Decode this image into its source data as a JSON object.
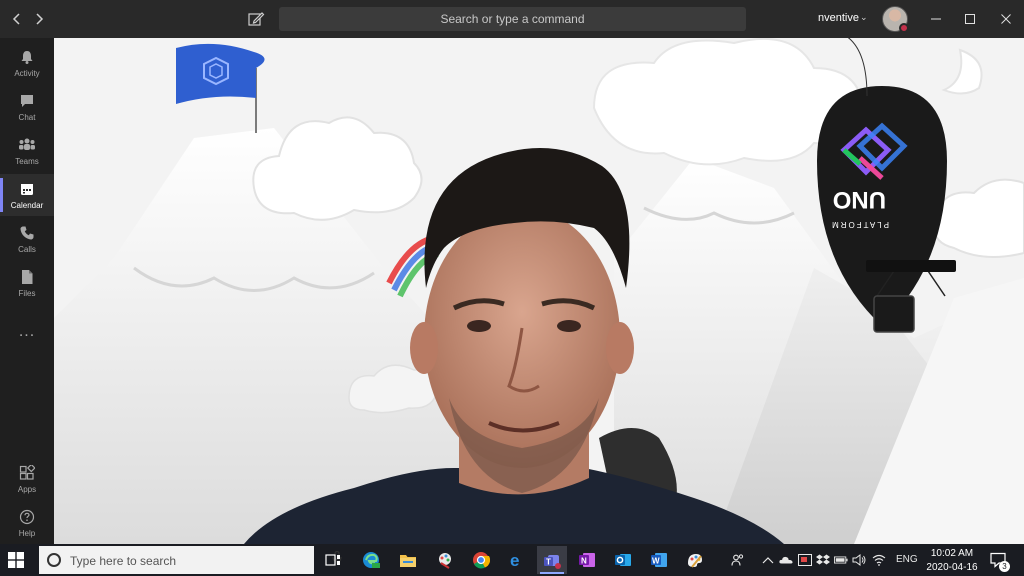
{
  "titlebar": {
    "search_placeholder": "Search or type a command",
    "tenant": "nventive"
  },
  "rail": {
    "items": [
      {
        "label": "Activity",
        "icon": "bell-icon"
      },
      {
        "label": "Chat",
        "icon": "chat-icon"
      },
      {
        "label": "Teams",
        "icon": "teams-icon"
      },
      {
        "label": "Calendar",
        "icon": "calendar-icon",
        "active": true
      },
      {
        "label": "Calls",
        "icon": "phone-icon"
      },
      {
        "label": "Files",
        "icon": "file-icon"
      }
    ],
    "more": "...",
    "bottom": [
      {
        "label": "Apps",
        "icon": "apps-icon"
      },
      {
        "label": "Help",
        "icon": "help-icon"
      }
    ]
  },
  "stage": {
    "balloon_logo_text": "UNO",
    "balloon_sub_text": "PLATFORM"
  },
  "taskbar": {
    "search_placeholder": "Type here to search",
    "language": "ENG",
    "time": "10:02 AM",
    "date": "2020-04-16",
    "notification_count": "3"
  },
  "colors": {
    "accent": "#7f85f5",
    "presence_busy": "#c4314b",
    "flag": "#2f5fd0"
  }
}
